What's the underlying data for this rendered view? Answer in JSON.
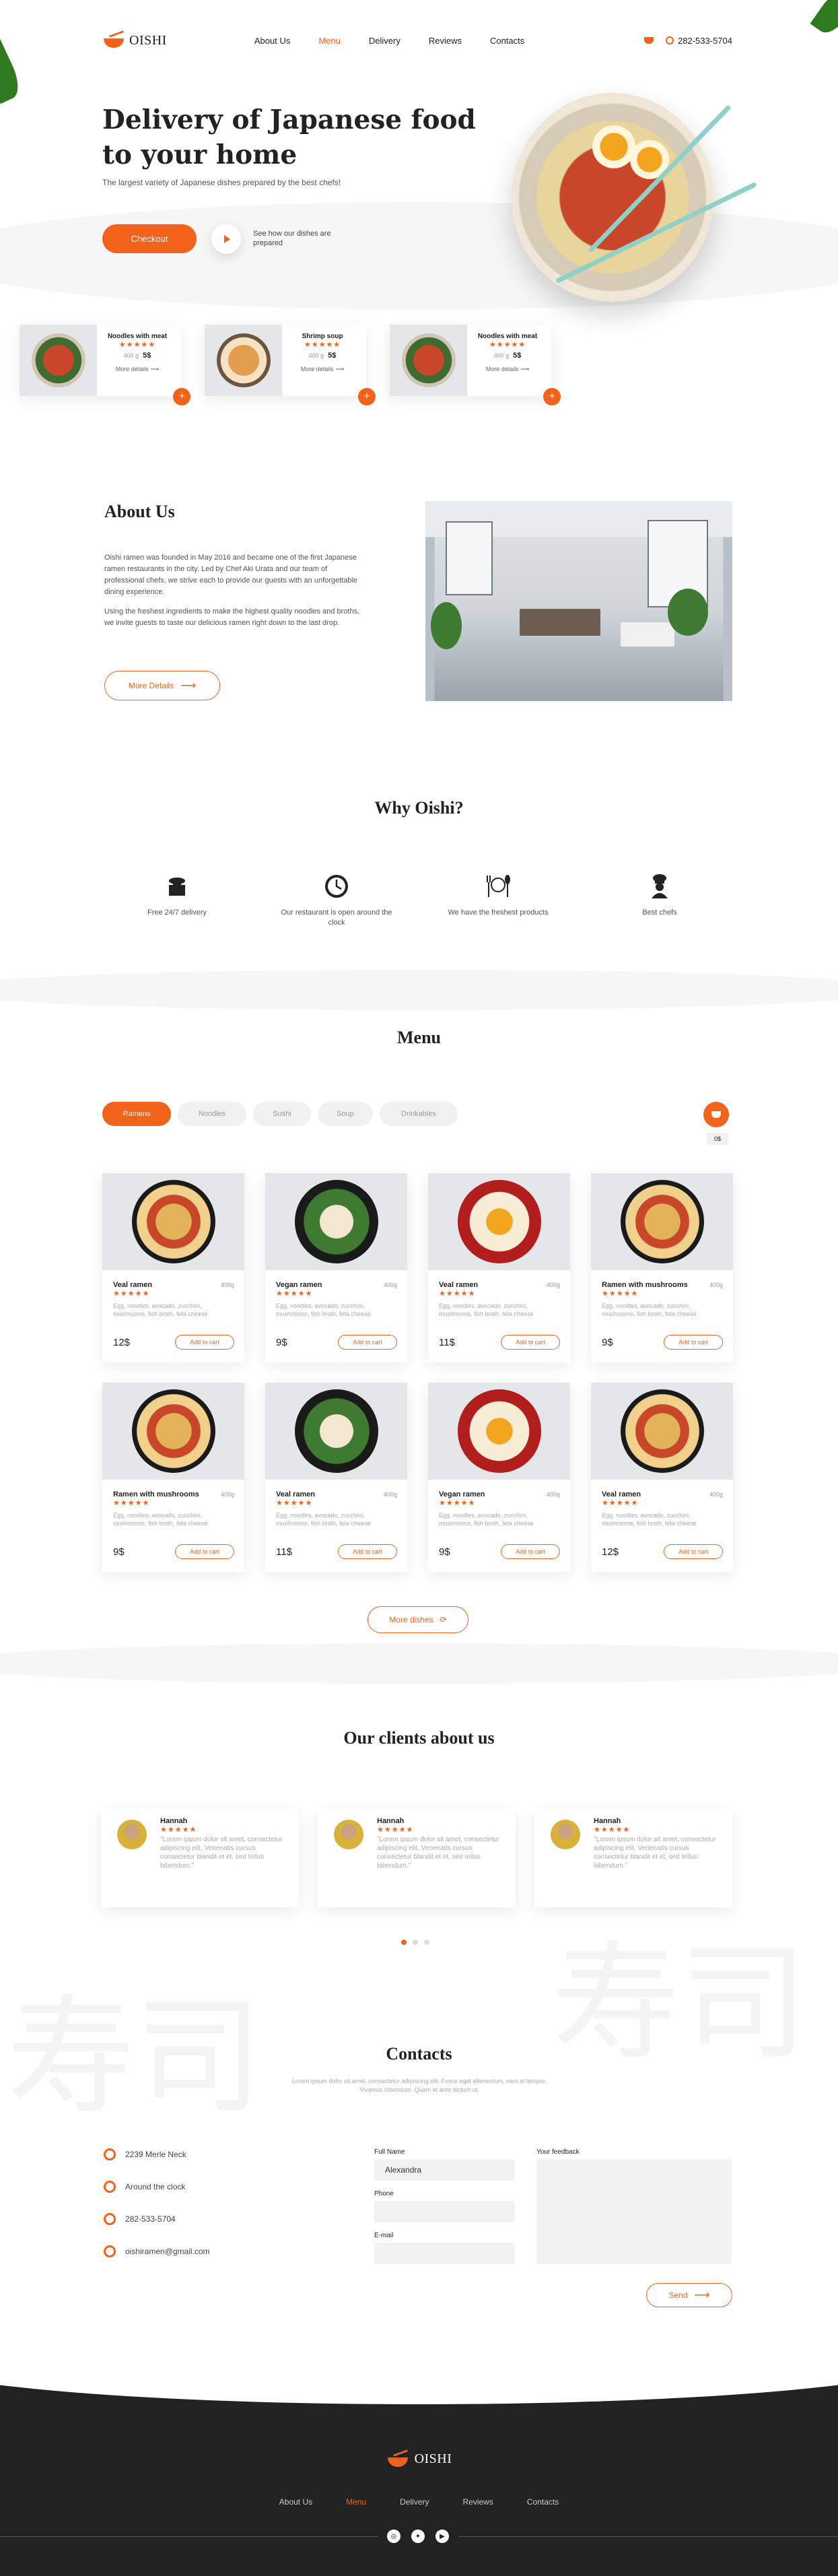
{
  "brand": {
    "name": "OISHI"
  },
  "nav": [
    "About Us",
    "Menu",
    "Delivery",
    "Reviews",
    "Contacts"
  ],
  "nav_active_index": 1,
  "header": {
    "phone": "282-533-5704"
  },
  "hero": {
    "title": "Delivery of Japanese food to your home",
    "subtitle": "The largest variety of Japanese dishes prepared by the best chefs!",
    "checkout_label": "Checkout",
    "video_label": "See how our dishes are prepared"
  },
  "featured": [
    {
      "title": "Noodles with meat",
      "stars": "★★★★★",
      "weight": "400 g",
      "price": "5$",
      "more": "More details"
    },
    {
      "title": "Shrimp soup",
      "stars": "★★★★★",
      "weight": "400 g",
      "price": "5$",
      "more": "More details"
    },
    {
      "title": "Noodles with meat",
      "stars": "★★★★★",
      "weight": "400 g",
      "price": "5$",
      "more": "More details"
    }
  ],
  "about": {
    "title": "About Us",
    "p1": "Oishi ramen was founded in May 2016 and became one of the first Japanese ramen restaurants in the city. Led by Chef Aki Urata and our team of professional chefs, we strive each to provide our guests with an unforgettable dining experience.",
    "p2": "Using the freshest ingredients to make the highest quality noodles and broths, we invite guests to taste our delicious ramen right down to the last drop.",
    "button": "More Details"
  },
  "why": {
    "title": "Why Oishi?",
    "items": [
      "Free 24/7 delivery",
      "Our restaurant is open around the clock",
      "We have the freshest products",
      "Best chefs"
    ]
  },
  "menu": {
    "title": "Menu",
    "tabs": [
      "Ramens",
      "Noodles",
      "Sushi",
      "Soup",
      "Drinkables"
    ],
    "active_tab": 0,
    "cart_count": "0$",
    "more_label": "More dishes",
    "items": [
      {
        "name": "Veal ramen",
        "weight": "400g",
        "stars": "★★★★★",
        "desc": "Egg, noodles, avocado, zucchini, mushrooms, fish broth, feta cheese",
        "price": "12$",
        "add": "Add to cart"
      },
      {
        "name": "Vegan ramen",
        "weight": "400g",
        "stars": "★★★★★",
        "desc": "Egg, noodles, avocado, zucchini, mushrooms, fish broth, feta cheese",
        "price": "9$",
        "add": "Add to cart"
      },
      {
        "name": "Veal ramen",
        "weight": "400g",
        "stars": "★★★★★",
        "desc": "Egg, noodles, avocado, zucchini, mushrooms, fish broth, feta cheese",
        "price": "11$",
        "add": "Add to cart"
      },
      {
        "name": "Ramen with mushrooms",
        "weight": "400g",
        "stars": "★★★★★",
        "desc": "Egg, noodles, avocado, zucchini, mushrooms, fish broth, feta cheese",
        "price": "9$",
        "add": "Add to cart"
      },
      {
        "name": "Ramen with mushrooms",
        "weight": "400g",
        "stars": "★★★★★",
        "desc": "Egg, noodles, avocado, zucchini, mushrooms, fish broth, feta cheese",
        "price": "9$",
        "add": "Add to cart"
      },
      {
        "name": "Veal ramen",
        "weight": "400g",
        "stars": "★★★★★",
        "desc": "Egg, noodles, avocado, zucchini, mushrooms, fish broth, feta cheese",
        "price": "11$",
        "add": "Add to cart"
      },
      {
        "name": "Vegan ramen",
        "weight": "400g",
        "stars": "★★★★★",
        "desc": "Egg, noodles, avocado, zucchini, mushrooms, fish broth, feta cheese",
        "price": "9$",
        "add": "Add to cart"
      },
      {
        "name": "Veal ramen",
        "weight": "400g",
        "stars": "★★★★★",
        "desc": "Egg, noodles, avocado, zucchini, mushrooms, fish broth, feta cheese",
        "price": "12$",
        "add": "Add to cart"
      }
    ]
  },
  "clients": {
    "title": "Our clients about us",
    "reviews": [
      {
        "name": "Hannah",
        "stars": "★★★★★",
        "text": "\"Lorem ipsum dolor sit amet, consectetur adipiscing elit. Venenatis cursus consectetur blandit et et, sed tellus bibendum.\""
      },
      {
        "name": "Hannah",
        "stars": "★★★★★",
        "text": "\"Lorem ipsum dolor sit amet, consectetur adipiscing elit. Venenatis cursus consectetur blandit et et, sed tellus bibendum.\""
      },
      {
        "name": "Hannah",
        "stars": "★★★★★",
        "text": "\"Lorem ipsum dolor sit amet, consectetur adipiscing elit. Venenatis cursus consectetur blandit et et, sed tellus bibendum.\""
      }
    ],
    "active_dot": 0
  },
  "watermark": "寿司",
  "contacts": {
    "title": "Contacts",
    "subtitle": "Lorem ipsum dolor sit amet, consectetur adipiscing elit. Fusce eget elementum, nam at tempor. Vivamus bibendum. Quam at ante dictum ut.",
    "address": "2239 Merle Neck",
    "hours": "Around the clock",
    "phone": "282-533-5704",
    "email": "oishiramen@gmail.com",
    "form": {
      "name_label": "Full Name",
      "name_value": "Alexandra",
      "phone_label": "Phone",
      "email_label": "E-mail",
      "feedback_label": "Your feedback",
      "send_label": "Send"
    }
  },
  "footer": {
    "nav": [
      "About Us",
      "Menu",
      "Delivery",
      "Reviews",
      "Contacts"
    ],
    "active_index": 1
  },
  "colors": {
    "accent": "#f3621a",
    "dark": "#222222",
    "card_bg": "#e4e6ea"
  }
}
